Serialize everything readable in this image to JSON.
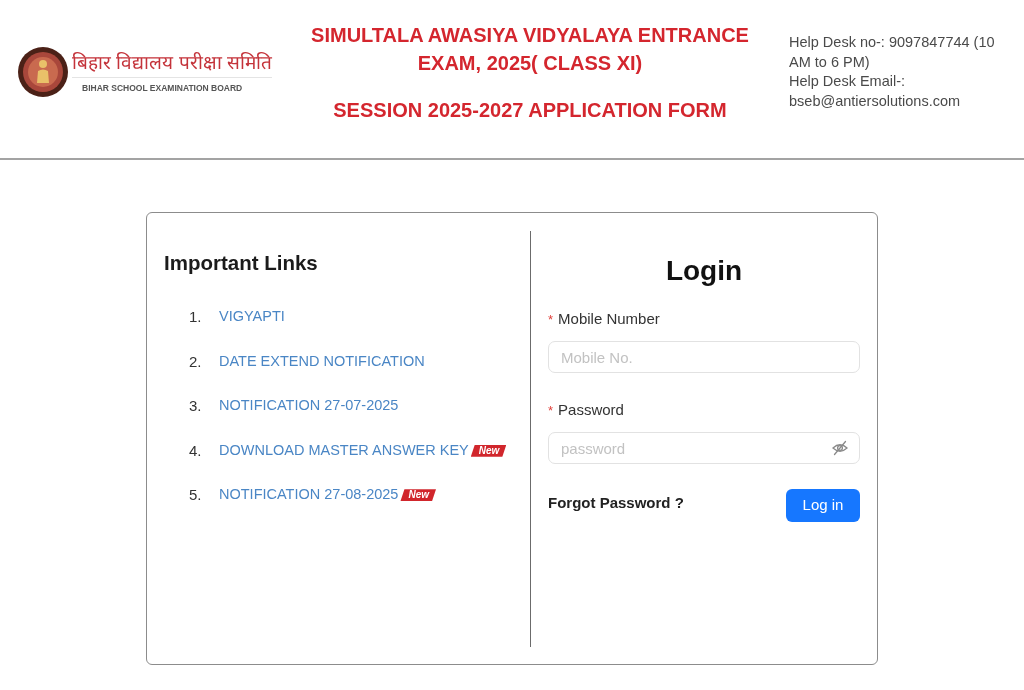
{
  "header": {
    "logo": {
      "hindi_name": "बिहार विद्यालय परीक्षा समिति",
      "english_name": "BIHAR SCHOOL EXAMINATION BOARD"
    },
    "title": "SIMULTALA AWASIYA VIDYALAYA ENTRANCE EXAM, 2025( CLASS XI)",
    "subtitle": "SESSION 2025-2027 APPLICATION FORM",
    "help_desk": {
      "phone": "Help Desk no-: 9097847744 (10 AM to 6 PM)",
      "email": "Help Desk Email-: bseb@antiersolutions.com"
    }
  },
  "important_links": {
    "title": "Important Links",
    "items": [
      {
        "number": "1.",
        "label": "VIGYAPTI"
      },
      {
        "number": "2.",
        "label": "DATE EXTEND NOTIFICATION"
      },
      {
        "number": "3.",
        "label": "NOTIFICATION 27-07-2025"
      },
      {
        "number": "4.",
        "label": "DOWNLOAD MASTER ANSWER KEY",
        "badge": "New"
      },
      {
        "number": "5.",
        "label": "NOTIFICATION 27-08-2025",
        "badge": "New"
      }
    ]
  },
  "login": {
    "title": "Login",
    "fields": [
      {
        "kind": "text",
        "required_mark": "*",
        "label": "Mobile Number",
        "placeholder": "Mobile No."
      },
      {
        "kind": "password",
        "required_mark": "*",
        "label": "Password",
        "placeholder": "password"
      }
    ],
    "forgot_link": "Forgot Password ?",
    "submit_button": "Log in"
  }
}
